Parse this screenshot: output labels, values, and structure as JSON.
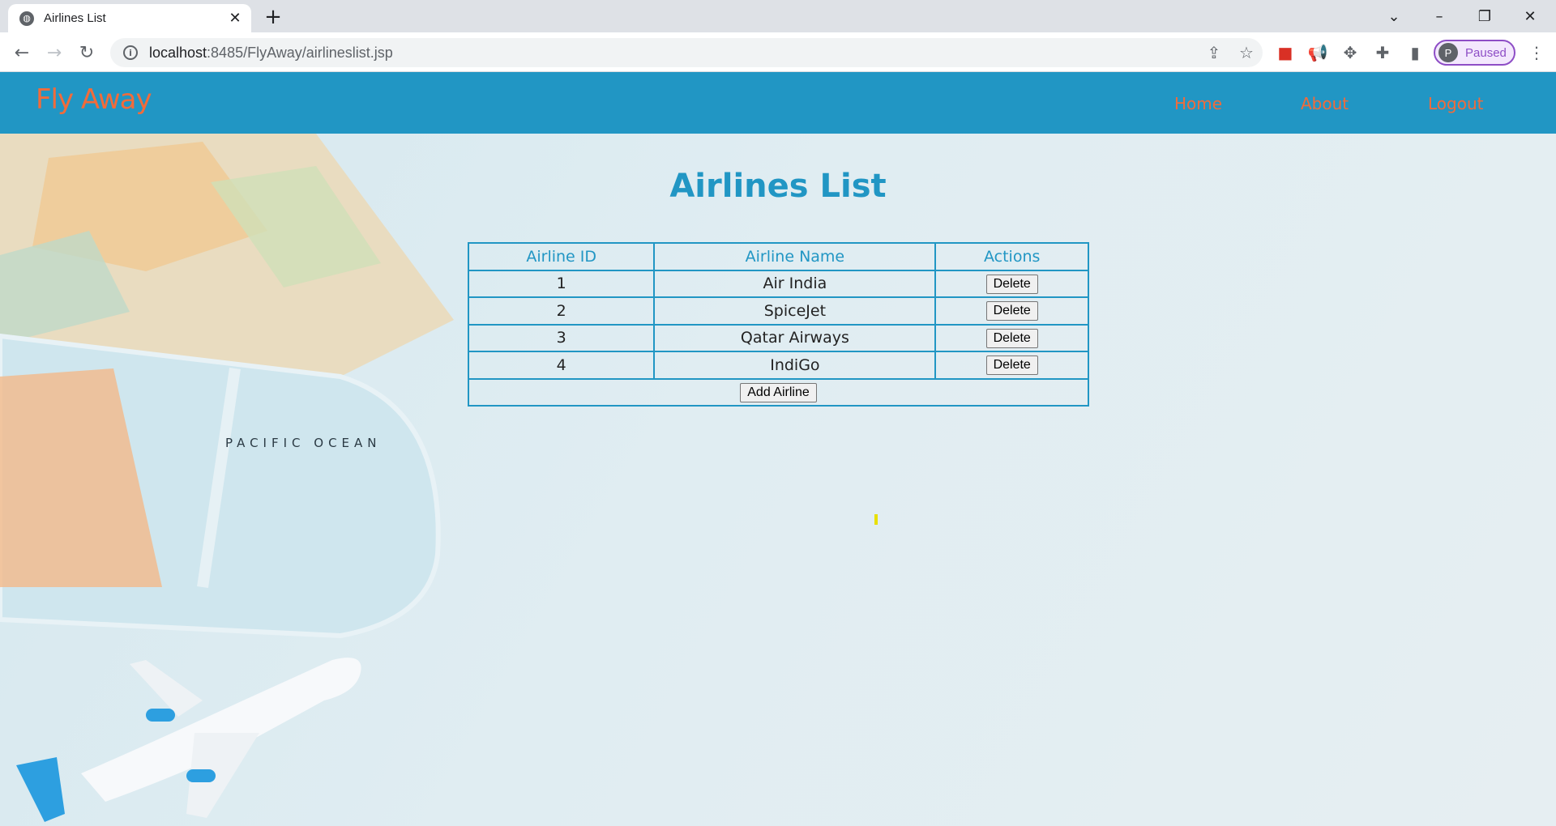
{
  "browser": {
    "tab_title": "Airlines List",
    "url_host": "localhost",
    "url_rest": ":8485/FlyAway/airlineslist.jsp",
    "profile_initial": "P",
    "profile_status": "Paused"
  },
  "navbar": {
    "brand": "Fly Away",
    "links": [
      {
        "label": "Home"
      },
      {
        "label": "About"
      },
      {
        "label": "Logout"
      }
    ]
  },
  "background_art": {
    "map_label": "PACIFIC OCEAN"
  },
  "main": {
    "title": "Airlines List",
    "table": {
      "headers": [
        "Airline ID",
        "Airline Name",
        "Actions"
      ],
      "rows": [
        {
          "id": "1",
          "name": "Air India",
          "action": "Delete"
        },
        {
          "id": "2",
          "name": "SpiceJet",
          "action": "Delete"
        },
        {
          "id": "3",
          "name": "Qatar Airways",
          "action": "Delete"
        },
        {
          "id": "4",
          "name": "IndiGo",
          "action": "Delete"
        }
      ],
      "add_button": "Add Airline"
    }
  },
  "colors": {
    "navbar_bg": "#2196c4",
    "accent_orange": "#f26b3a",
    "heading_blue": "#2196c4"
  }
}
